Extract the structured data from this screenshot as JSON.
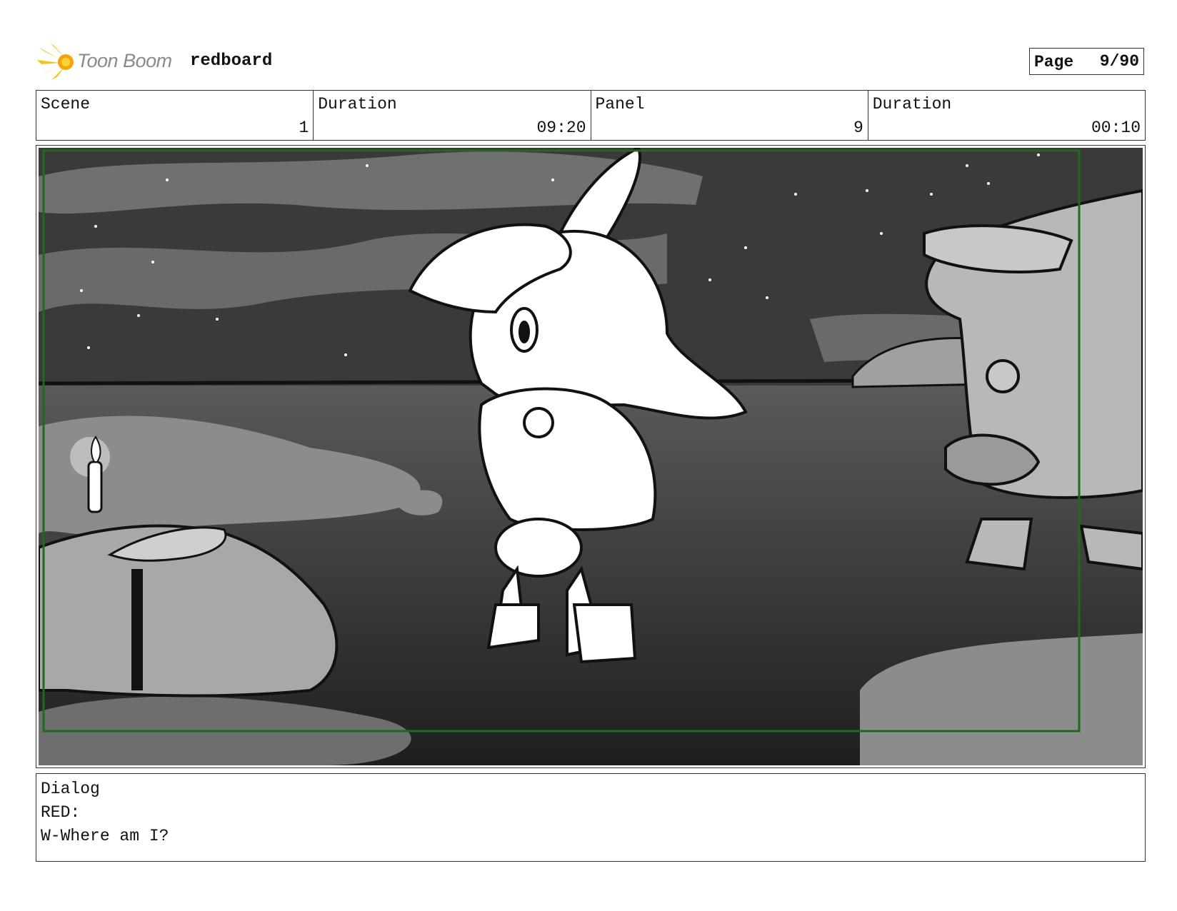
{
  "header": {
    "logo_text": "Toon Boom",
    "project": "redboard",
    "page_label": "Page",
    "page_value": "9/90"
  },
  "info": {
    "scene_label": "Scene",
    "scene_value": "1",
    "scene_duration_label": "Duration",
    "scene_duration_value": "09:20",
    "panel_label": "Panel",
    "panel_value": "9",
    "panel_duration_label": "Duration",
    "panel_duration_value": "00:10"
  },
  "dialog": {
    "label": "Dialog",
    "speaker": "RED:",
    "line": "W-Where am I?"
  },
  "colors": {
    "safe_frame": "#1d6b1d",
    "sky": "#3b3b3b",
    "water": "#4a4a4a"
  }
}
